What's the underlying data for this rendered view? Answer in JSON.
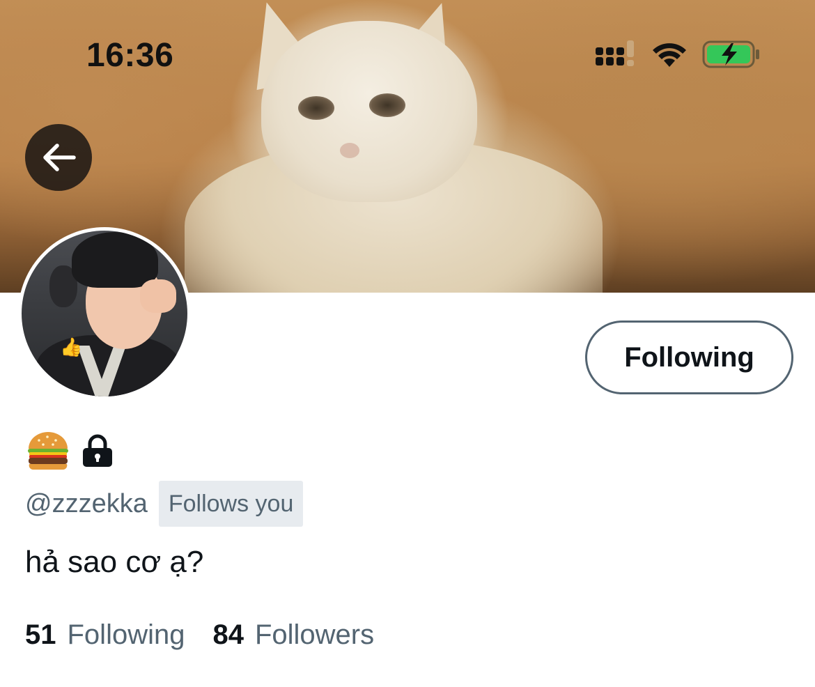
{
  "status_bar": {
    "time": "16:36",
    "signal_icon": "signal-icon",
    "wifi_icon": "wifi-icon",
    "battery_icon": "battery-charging-icon",
    "battery_color": "#34c759"
  },
  "header": {
    "back_icon": "arrow-left-icon"
  },
  "profile": {
    "follow_button_label": "Following",
    "name_emoji": "🍔",
    "protected_icon": "lock-icon",
    "handle": "@zzzekka",
    "follows_you_badge": "Follows you",
    "bio": "hả sao cơ ạ?",
    "following_count": "51",
    "following_label": "Following",
    "followers_count": "84",
    "followers_label": "Followers"
  },
  "colors": {
    "primary_text": "#0f1419",
    "secondary_text": "#536471",
    "badge_background": "#e7ebef"
  }
}
